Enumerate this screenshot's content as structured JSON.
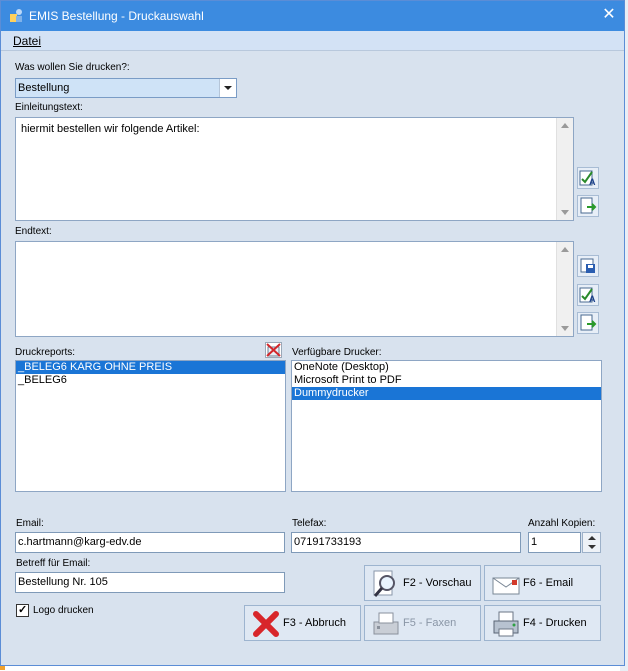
{
  "window": {
    "title": "EMIS Bestellung - Druckauswahl",
    "close_icon": "close-icon"
  },
  "menu": {
    "datei": "Datei"
  },
  "print_what": {
    "label": "Was wollen Sie drucken?:",
    "selected": "Bestellung"
  },
  "intro": {
    "label": "Einleitungstext:",
    "text": "hiermit bestellen wir folgende Artikel:"
  },
  "end": {
    "label": "Endtext:",
    "text": ""
  },
  "reports": {
    "label": "Druckreports:",
    "items": [
      {
        "label": "_BELEG6 KARG OHNE PREIS",
        "selected": true
      },
      {
        "label": "_BELEG6",
        "selected": false
      }
    ]
  },
  "printers": {
    "label": "Verfügbare Drucker:",
    "items": [
      {
        "label": "OneNote (Desktop)",
        "selected": false
      },
      {
        "label": "Microsoft Print to PDF",
        "selected": false
      },
      {
        "label": "Dummydrucker",
        "selected": true
      }
    ]
  },
  "email": {
    "label": "Email:",
    "value": "c.hartmann@karg-edv.de"
  },
  "fax": {
    "label": "Telefax:",
    "value": "07191733193"
  },
  "copies": {
    "label": "Anzahl Kopien:",
    "value": "1"
  },
  "subject": {
    "label": "Betreff für Email:",
    "value": "Bestellung Nr. 105"
  },
  "logo": {
    "label": "Logo drucken",
    "checked": true
  },
  "buttons": {
    "preview": "F2 - Vorschau",
    "email": "F6 - Email",
    "cancel": "F3 - Abbruch",
    "fax": "F5 - Faxen",
    "print": "F4 - Drucken"
  },
  "colors": {
    "titlebar": "#3c8be0",
    "window_bg": "#d8e2ee",
    "selection": "#1a75d6"
  }
}
